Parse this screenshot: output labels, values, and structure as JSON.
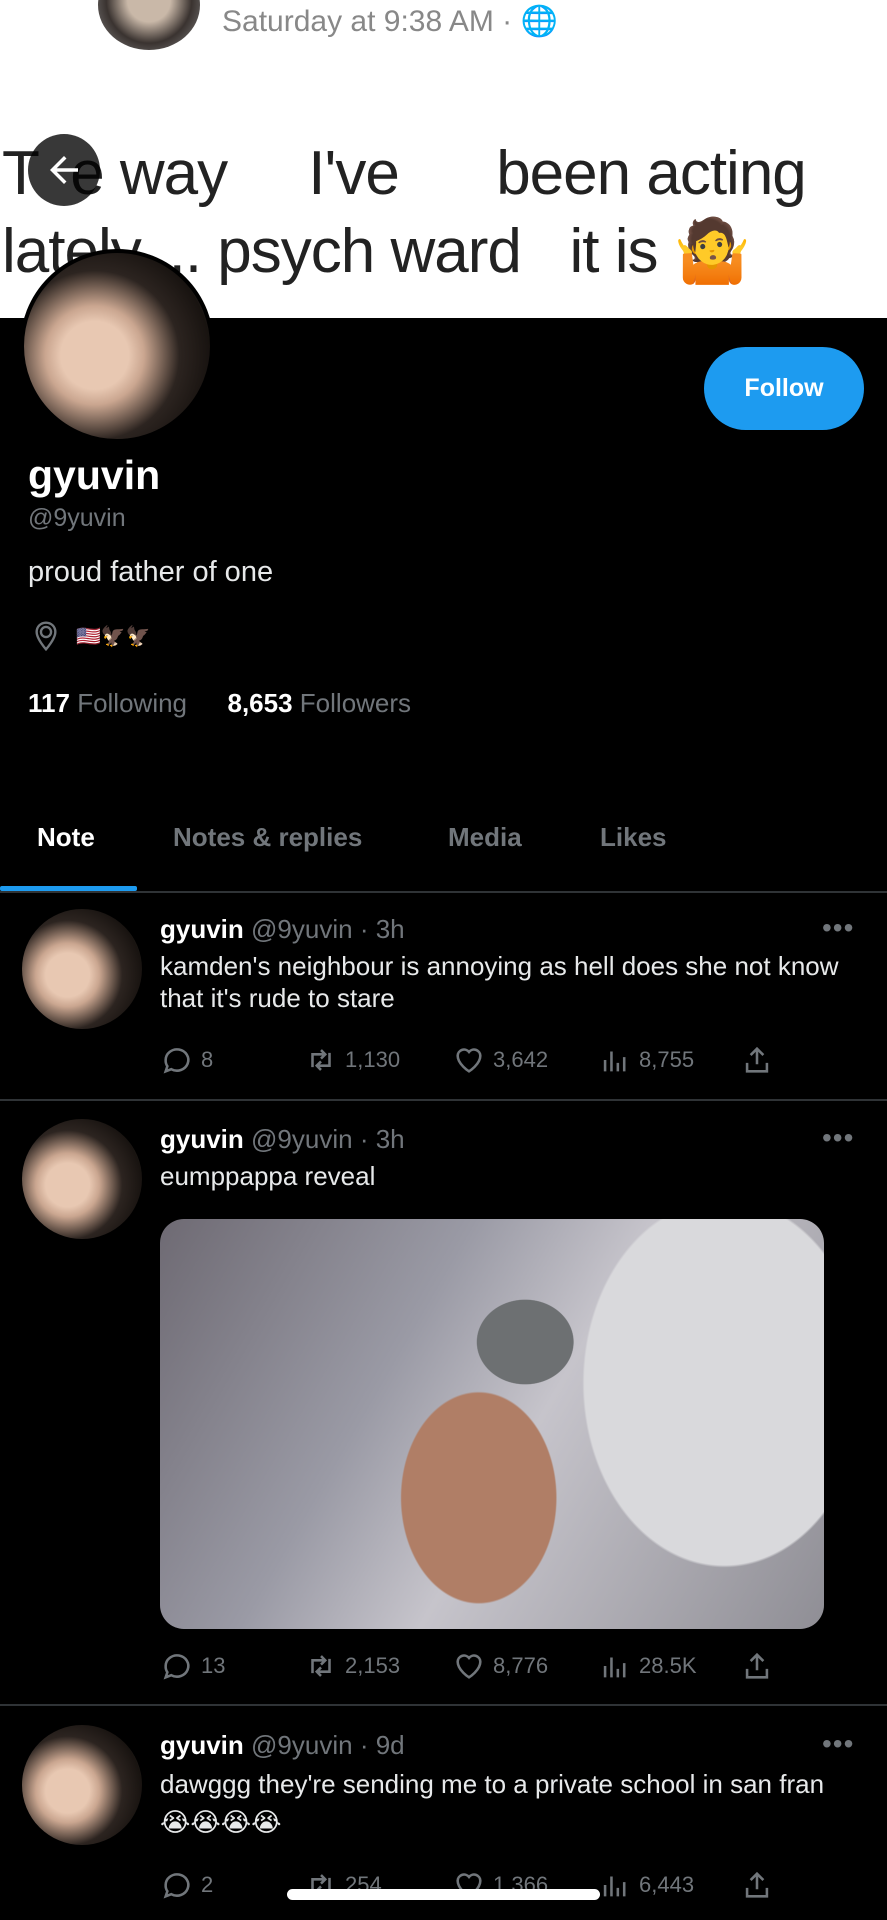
{
  "banner": {
    "timestamp": "Saturday at 9:38 AM · ",
    "line1": "T  e way     I've      been acting",
    "line2": "lately.... psych ward   it is",
    "emoji": "🤷"
  },
  "profile": {
    "follow_label": "Follow",
    "display_name": "gyuvin",
    "handle": "@9yuvin",
    "bio": "proud father of one",
    "location": "🇺🇸🦅🦅",
    "following_count": "117",
    "following_label": "Following",
    "followers_count": "8,653",
    "followers_label": "Followers"
  },
  "tabs": [
    {
      "label": "Note",
      "active": true
    },
    {
      "label": "Notes & replies",
      "active": false
    },
    {
      "label": "Media",
      "active": false
    },
    {
      "label": "Likes",
      "active": false
    }
  ],
  "tweets": [
    {
      "name": "gyuvin",
      "handle": "@9yuvin",
      "time": "· 3h",
      "text": "kamden's neighbour is annoying as hell does she not know that it's rude to stare",
      "replies": "8",
      "retweets": "1,130",
      "likes": "3,642",
      "views": "8,755"
    },
    {
      "name": "gyuvin",
      "handle": "@9yuvin",
      "time": "· 3h",
      "text": "eumppappa reveal",
      "replies": "13",
      "retweets": "2,153",
      "likes": "8,776",
      "views": "28.5K"
    },
    {
      "name": "gyuvin",
      "handle": "@9yuvin",
      "time": "· 9d",
      "text": "dawggg they're sending me to a private school in san fran 😭😭😭😭",
      "replies": "2",
      "retweets": "254",
      "likes": "1,366",
      "views": "6,443"
    }
  ],
  "colors": {
    "accent": "#1d9bf0",
    "muted": "#71767b",
    "background": "#000000"
  }
}
